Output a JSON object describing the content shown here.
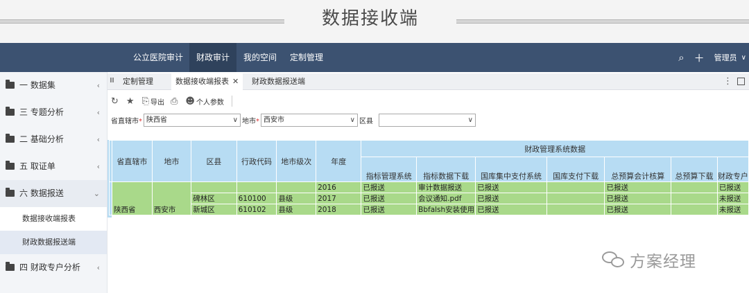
{
  "banner": {
    "title": "数据接收端"
  },
  "topnav": {
    "items": [
      "公立医院审计",
      "财政审计",
      "我的空间",
      "定制管理"
    ],
    "active_index": 1,
    "user": "管理员",
    "icons": [
      "search-icon",
      "plus-icon",
      "chevron-down-icon"
    ]
  },
  "sidebar": {
    "items": [
      {
        "label": "一 数据集",
        "chevron": "‹"
      },
      {
        "label": "三 专题分析",
        "chevron": "‹"
      },
      {
        "label": "二 基础分析",
        "chevron": "‹"
      },
      {
        "label": "五 取证单",
        "chevron": "‹"
      },
      {
        "label": "六 数据报送",
        "chevron": "⌄"
      },
      {
        "label": "四 财政专户分析",
        "chevron": "‹"
      }
    ],
    "sub_items": [
      "数据接收端报表",
      "财政数据报送端"
    ],
    "active_sub_index": 1
  },
  "tabs": {
    "items": [
      {
        "label": "定制管理",
        "closable": false
      },
      {
        "label": "数据接收端报表",
        "closable": true
      },
      {
        "label": "财政数据报送端",
        "closable": false
      }
    ],
    "active_index": 1,
    "close_glyph": "✕",
    "menu_glyph": "⋮"
  },
  "toolbar": {
    "export_label": "导出",
    "params_label": "个人参数",
    "icons": [
      "refresh-icon",
      "star-icon",
      "export-icon",
      "print-icon",
      "users-icon"
    ]
  },
  "filters": {
    "province_label": "省直辖市",
    "province_value": "陕西省",
    "city_label": "地市",
    "city_value": "西安市",
    "district_label": "区县",
    "district_value": "",
    "required_mark": "*"
  },
  "table": {
    "group_header": "财政管理系统数据",
    "fixed_headers": [
      "省直辖市",
      "地市",
      "区县",
      "行政代码",
      "地市级次",
      "年度"
    ],
    "sub_headers": [
      "指标管理系统",
      "指标数据下载",
      "国库集中支付系统",
      "国库支付下载",
      "总预算会计核算",
      "总预算下载",
      "财政专户"
    ],
    "rows": [
      {
        "province": "",
        "city": "",
        "district": "",
        "code": "",
        "level": "",
        "year": "2016",
        "cells": [
          "已报送",
          "审计数据报送",
          "已报送",
          "",
          "已报送",
          "",
          "已报送"
        ]
      },
      {
        "province": "",
        "city": "",
        "district": "碑林区",
        "code": "610100",
        "level": "县级",
        "year": "2017",
        "cells": [
          "已报送",
          "会议通知.pdf",
          "已报送",
          "",
          "已报送",
          "",
          "未报送"
        ]
      },
      {
        "province": "陕西省",
        "city": "西安市",
        "district": "新城区",
        "code": "610102",
        "level": "县级",
        "year": "2018",
        "cells": [
          "已报送",
          "Bbfalsh安装使用",
          "已报送",
          "",
          "已报送",
          "",
          "未报送"
        ]
      }
    ]
  },
  "watermark": {
    "text": "方案经理"
  }
}
